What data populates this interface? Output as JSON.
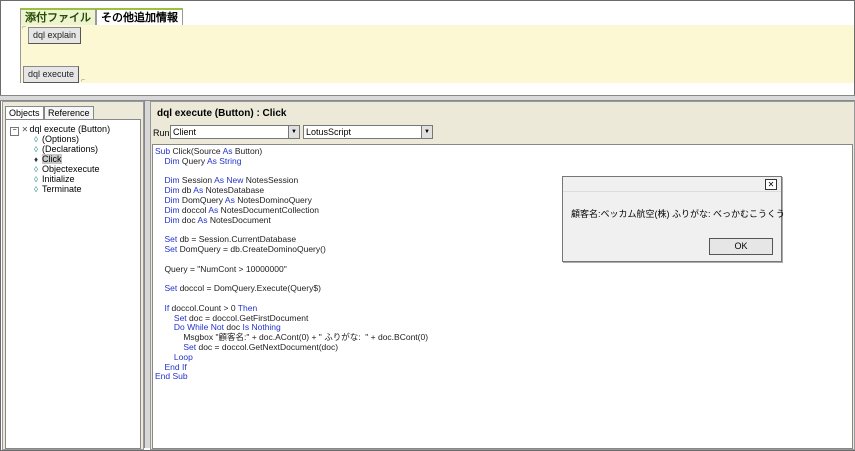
{
  "form": {
    "tabs": [
      "添付ファイル",
      "その他追加情報"
    ],
    "buttons": {
      "explain": "dql explain",
      "execute": "dql execute"
    }
  },
  "objects_panel": {
    "tabs": [
      "Objects",
      "Reference"
    ],
    "tree_root": "dql execute (Button)",
    "tree_items": [
      "(Options)",
      "(Declarations)",
      "Click",
      "Objectexecute",
      "Initialize",
      "Terminate"
    ],
    "selected": "Click"
  },
  "editor": {
    "title": "dql execute (Button) : Click",
    "run_label": "Run",
    "run_target": "Client",
    "language": "LotusScript",
    "code_lines": [
      "Sub Click(Source As Button)",
      "    Dim Query As String",
      "",
      "    Dim Session As New NotesSession",
      "    Dim db As NotesDatabase",
      "    Dim DomQuery As NotesDominoQuery",
      "    Dim doccol As NotesDocumentCollection",
      "    Dim doc As NotesDocument",
      "",
      "    Set db = Session.CurrentDatabase",
      "    Set DomQuery = db.CreateDominoQuery()",
      "",
      "    Query = \"NumCont > 10000000\"",
      "",
      "    Set doccol = DomQuery.Execute(Query$)",
      "",
      "    If doccol.Count > 0 Then",
      "        Set doc = doccol.GetFirstDocument",
      "        Do While Not doc Is Nothing",
      "            Msgbox \"顧客名:\" + doc.ACont(0) + \" ふりがな:  \" + doc.BCont(0)",
      "            Set doc = doccol.GetNextDocument(doc)",
      "        Loop",
      "    End If",
      "End Sub"
    ]
  },
  "dialog": {
    "close_glyph": "✕",
    "message": "顧客名:ベッカム航空(株) ふりがな:  べっかむこうくう",
    "ok_label": "OK"
  }
}
